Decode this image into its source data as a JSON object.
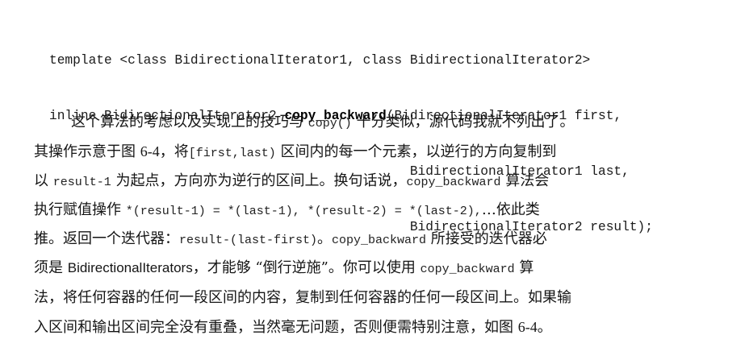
{
  "code": {
    "line1": "template <class BidirectionalIterator1, class BidirectionalIterator2>",
    "line2_pre": "inline BidirectionalIterator2 ",
    "func_name": "copy_backward",
    "line2_post": "(BidirectionalIterator1 first,",
    "line3": "                                              BidirectionalIterator1 last,",
    "line4": "                                              BidirectionalIterator2 result);"
  },
  "paragraph": {
    "l1a": "这个算法的考虑以及实现上的技巧与 ",
    "l1b": "copy()",
    "l1c": " 十分类似，源代码我就不列出了。",
    "l2a": "其操作示意于图 ",
    "l2b": "6-4",
    "l2c": "，将",
    "l2d": "[first,last)",
    "l2e": " 区间内的每一个元素，以逆行的方向复制到",
    "l3a": "以 ",
    "l3b": "result-1",
    "l3c": " 为起点，方向亦为逆行的区间上。换句话说，",
    "l3d": "copy_backward",
    "l3e": " 算法会",
    "l4a": "执行赋值操作 ",
    "l4b": "*(result-1) = *(last-1), *(result-2) = *(last-2),",
    "l4c": "…依此类",
    "l5a": "推。返回一个迭代器：",
    "l5b": "result-(last-first)",
    "l5c": "。",
    "l5d": "copy_backward",
    "l5e": " 所接受的迭代器必",
    "l6a": "须是 ",
    "l6b": "BidirectionalIterators",
    "l6c": "，才能够 “倒行逆施”。你可以使用 ",
    "l6d": "copy_backward",
    "l6e": " 算",
    "l7": "法，将任何容器的任何一段区间的内容，复制到任何容器的任何一段区间上。如果输",
    "l8a": "入区间和输出区间完全没有重叠，当然毫无问题，否则便需特别注意，如图 ",
    "l8b": "6-4",
    "l8c": "。"
  }
}
